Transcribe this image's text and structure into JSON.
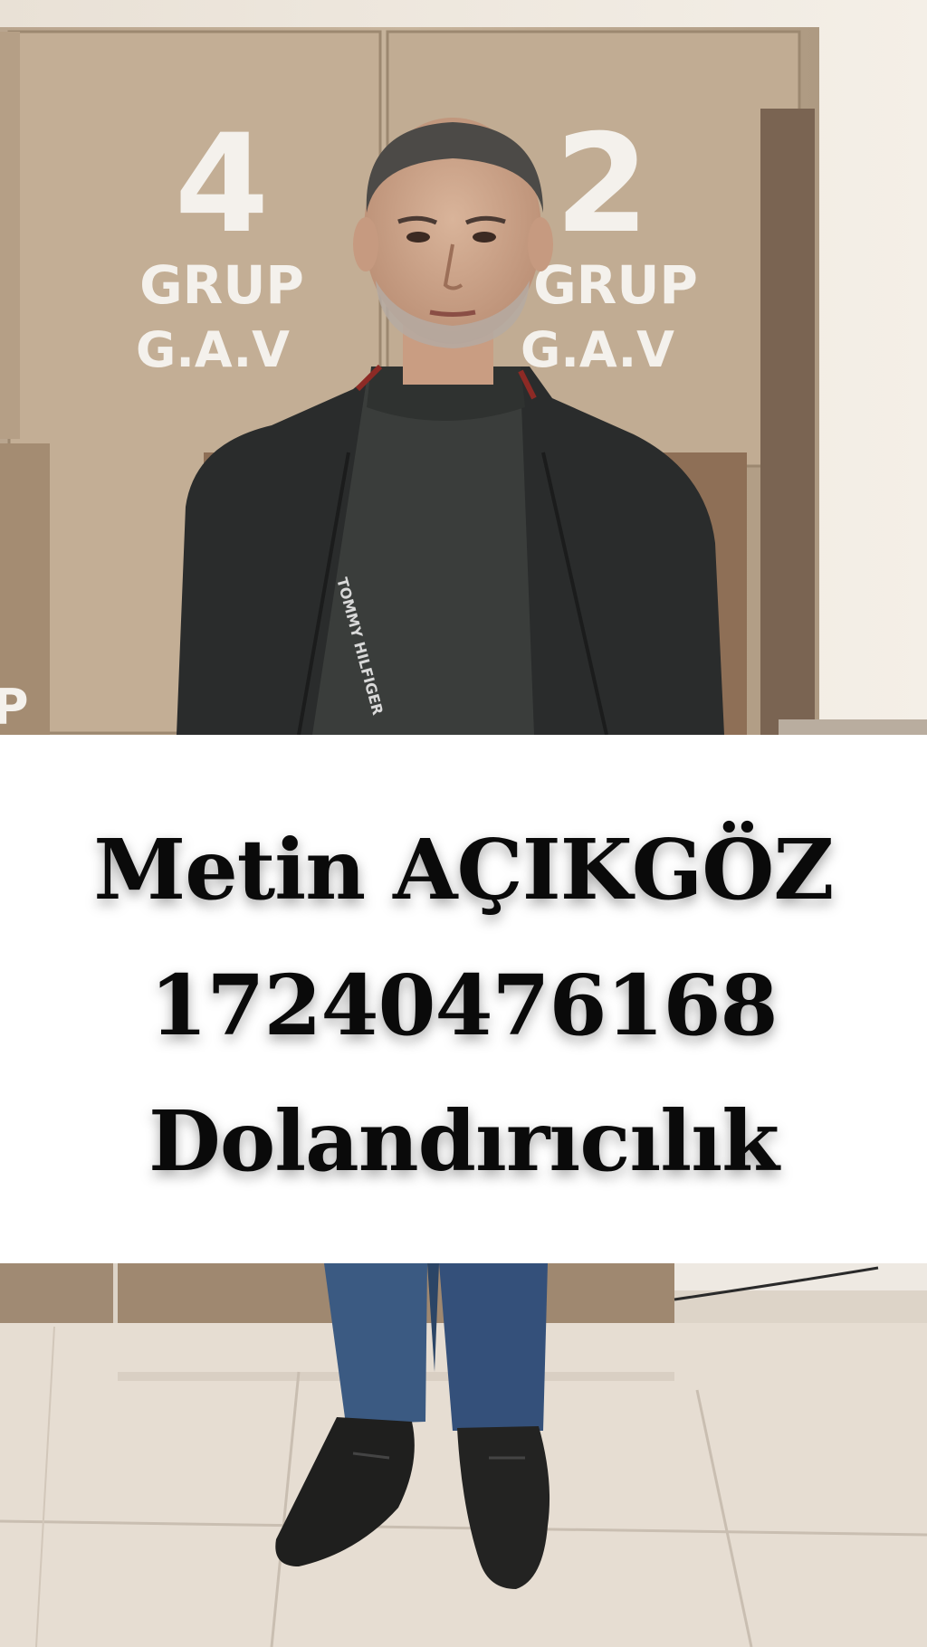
{
  "photo": {
    "locker_numbers": [
      "4",
      "2"
    ],
    "locker_group_label": "GRUP",
    "locker_sub_label": "G.A.V",
    "jacket_brand_text": "TOMMY HILFIGER"
  },
  "caption": {
    "name": "Metin AÇIKGÖZ",
    "id_number": "17240476168",
    "charge": "Dolandırıcılık"
  }
}
